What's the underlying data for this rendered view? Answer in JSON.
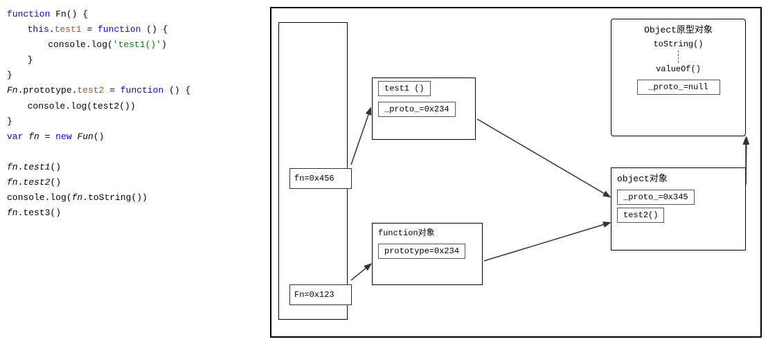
{
  "code": {
    "lines": [
      {
        "id": "l1",
        "tokens": [
          {
            "t": "kw",
            "v": "function"
          },
          {
            "t": "normal",
            "v": " Fn() {"
          }
        ]
      },
      {
        "id": "l2",
        "indent": 1,
        "tokens": [
          {
            "t": "this",
            "v": "this"
          },
          {
            "t": "normal",
            "v": "."
          },
          {
            "t": "prop",
            "v": "test1"
          },
          {
            "t": "normal",
            "v": " = "
          },
          {
            "t": "kw",
            "v": "function"
          },
          {
            "t": "normal",
            "v": " () {"
          }
        ]
      },
      {
        "id": "l3",
        "indent": 2,
        "tokens": [
          {
            "t": "normal",
            "v": "console.log("
          },
          {
            "t": "str",
            "v": "'test1()'"
          },
          {
            "t": "normal",
            "v": ")"
          }
        ]
      },
      {
        "id": "l4",
        "indent": 1,
        "tokens": [
          {
            "t": "normal",
            "v": "}"
          }
        ]
      },
      {
        "id": "l5",
        "tokens": [
          {
            "t": "normal",
            "v": "}"
          }
        ]
      },
      {
        "id": "l6",
        "tokens": [
          {
            "t": "italic",
            "v": "Fn"
          },
          {
            "t": "normal",
            "v": ".prototype."
          },
          {
            "t": "prop",
            "v": "test2"
          },
          {
            "t": "normal",
            "v": " = "
          },
          {
            "t": "kw",
            "v": "function"
          },
          {
            "t": "normal",
            "v": " () {"
          }
        ]
      },
      {
        "id": "l7",
        "indent": 1,
        "tokens": [
          {
            "t": "normal",
            "v": "console.log(test2())"
          }
        ]
      },
      {
        "id": "l8",
        "tokens": [
          {
            "t": "normal",
            "v": "}"
          }
        ]
      },
      {
        "id": "l9",
        "tokens": [
          {
            "t": "kw",
            "v": "var"
          },
          {
            "t": "normal",
            "v": " "
          },
          {
            "t": "italic",
            "v": "fn"
          },
          {
            "t": "normal",
            "v": " = "
          },
          {
            "t": "kw",
            "v": "new"
          },
          {
            "t": "normal",
            "v": " "
          },
          {
            "t": "italic",
            "v": "Fun"
          },
          {
            "t": "normal",
            "v": "()"
          }
        ]
      },
      {
        "id": "l10",
        "tokens": []
      },
      {
        "id": "l11",
        "tokens": [
          {
            "t": "italic",
            "v": "fn"
          },
          {
            "t": "normal",
            "v": "."
          },
          {
            "t": "italic",
            "v": "test1"
          },
          {
            "t": "normal",
            "v": "()"
          }
        ]
      },
      {
        "id": "l12",
        "tokens": [
          {
            "t": "italic",
            "v": "fn"
          },
          {
            "t": "normal",
            "v": "."
          },
          {
            "t": "italic",
            "v": "test2"
          },
          {
            "t": "normal",
            "v": "()"
          }
        ]
      },
      {
        "id": "l13",
        "tokens": [
          {
            "t": "normal",
            "v": "console.log("
          },
          {
            "t": "italic",
            "v": "fn"
          },
          {
            "t": "normal",
            "v": ".toString())"
          }
        ]
      },
      {
        "id": "l14",
        "tokens": [
          {
            "t": "italic",
            "v": "fn"
          },
          {
            "t": "normal",
            "v": ".test3()"
          }
        ]
      }
    ]
  },
  "diagram": {
    "fn_label": "fn=0x456",
    "Fn_label": "Fn=0x123",
    "instance_box": {
      "row1": "test1 ()",
      "row2": "_proto_=0x234"
    },
    "func_obj": {
      "title": "function对象",
      "cell": "prototype=0x234"
    },
    "obj_proto": {
      "title": "Object原型对象",
      "item1": "toString()",
      "item2": "valueOf()",
      "null_cell": "_proto_=null"
    },
    "obj_instance": {
      "title": "object对象",
      "cell1": "_proto_=0x345",
      "cell2": "test2()"
    }
  }
}
